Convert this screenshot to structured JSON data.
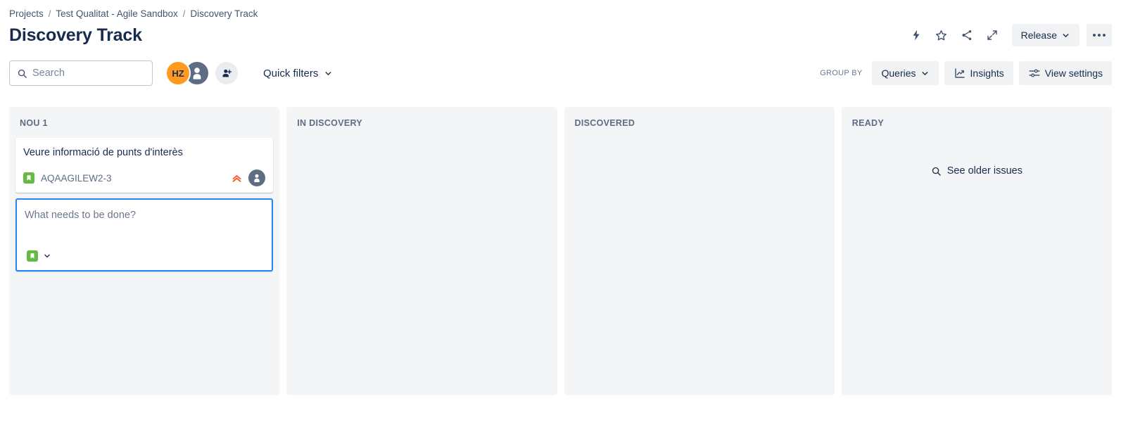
{
  "breadcrumb": {
    "items": [
      {
        "label": "Projects"
      },
      {
        "label": "Test Qualitat - Agile Sandbox"
      },
      {
        "label": "Discovery Track"
      }
    ],
    "separator": "/"
  },
  "header": {
    "title": "Discovery Track",
    "actions": {
      "automation_icon": "lightning-bolt-icon",
      "star_icon": "star-icon",
      "share_icon": "share-icon",
      "expand_icon": "expand-icon",
      "release_label": "Release",
      "more_label": "•••"
    }
  },
  "toolbar": {
    "search": {
      "placeholder": "Search",
      "value": ""
    },
    "avatars": [
      {
        "initials": "HZ",
        "color": "#FF991F",
        "name": "avatar-hz"
      },
      {
        "initials": "",
        "color": "#5E6C84",
        "name": "avatar-default-user"
      }
    ],
    "add_person_icon": "add-person-icon",
    "quick_filters_label": "Quick filters",
    "group_by_label": "GROUP BY",
    "queries_label": "Queries",
    "insights_label": "Insights",
    "view_settings_label": "View settings"
  },
  "board": {
    "columns": [
      {
        "title": "NOU 1",
        "cards": [
          {
            "title": "Veure informació de punts d'interès",
            "key": "AQAAGILEW2-3",
            "type_icon": "story-icon",
            "type_color": "#65BA43",
            "priority_icon": "highest-priority-icon",
            "priority_color": "#FF5630",
            "avatar_color": "#5E6C84"
          }
        ],
        "create_card": {
          "placeholder": "What needs to be done?",
          "value": "",
          "type_icon": "story-icon",
          "type_color": "#65BA43"
        }
      },
      {
        "title": "IN DISCOVERY",
        "cards": []
      },
      {
        "title": "DISCOVERED",
        "cards": []
      },
      {
        "title": "READY",
        "cards": [],
        "see_older_label": "See older issues"
      }
    ]
  }
}
